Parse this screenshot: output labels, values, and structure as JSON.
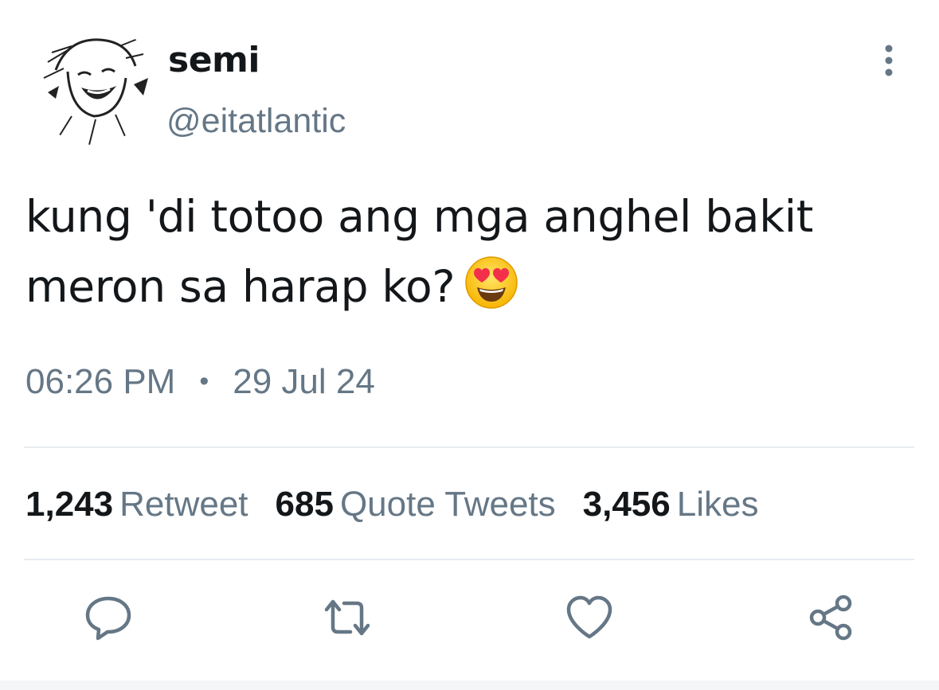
{
  "author": {
    "display_name": "semi",
    "handle": "@eitatlantic"
  },
  "tweet": {
    "text": "kung 'di totoo ang mga anghel bakit meron sa harap ko?",
    "emoji": "smiling-face-with-heart-eyes",
    "time": "06:26 PM",
    "separator": "•",
    "date": "29 Jul 24"
  },
  "stats": {
    "retweets_count": "1,243",
    "retweets_label": "Retweet",
    "quotes_count": "685",
    "quotes_label": "Quote Tweets",
    "likes_count": "3,456",
    "likes_label": "Likes"
  },
  "colors": {
    "text_primary": "#14171a",
    "text_secondary": "#657786",
    "divider": "#e6ecf0"
  },
  "icons": {
    "more": "more-vertical-icon",
    "reply": "reply-icon",
    "retweet": "retweet-icon",
    "like": "heart-icon",
    "share": "share-icon"
  }
}
